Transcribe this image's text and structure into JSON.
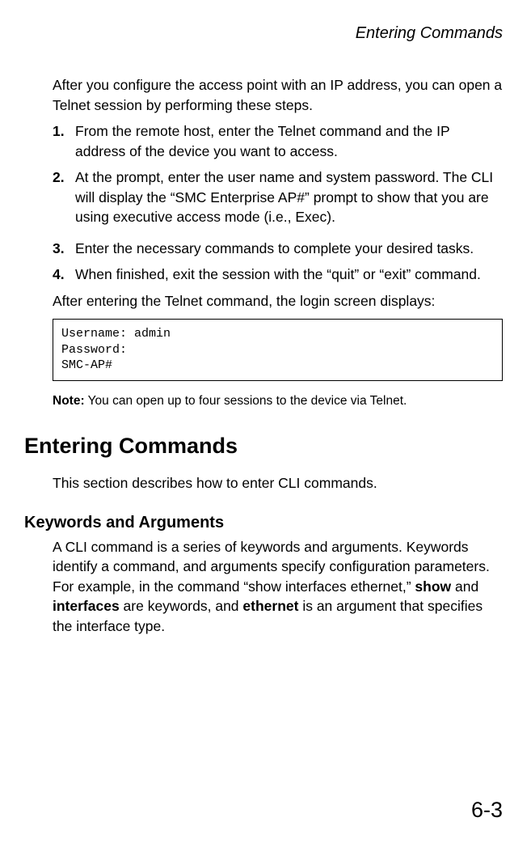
{
  "header": {
    "title": "Entering Commands"
  },
  "intro": "After you configure the access point with an IP address, you can open a Telnet session by performing these steps.",
  "steps": [
    {
      "num": "1.",
      "text": "From the remote host, enter the Telnet command and the IP address of the device you want to access."
    },
    {
      "num": "2.",
      "text": "At the prompt, enter the user name and system password. The CLI will display the “SMC Enterprise AP#” prompt to show that you are using executive access mode (i.e., Exec)."
    },
    {
      "num": "3.",
      "text": "Enter the necessary commands to complete your desired tasks."
    },
    {
      "num": "4.",
      "text": "When finished, exit the session with the “quit” or “exit” command."
    }
  ],
  "after_list": "After entering the Telnet command, the login screen displays:",
  "codebox": "Username: admin\nPassword:\nSMC-AP#",
  "note": {
    "label": "Note:",
    "text": "You can open up to four sessions to the device via Telnet."
  },
  "section": {
    "heading": "Entering Commands",
    "para": "This section describes how to enter CLI commands."
  },
  "subsection": {
    "heading": "Keywords and Arguments",
    "para_parts": {
      "p1": "A CLI command is a series of keywords and arguments. Keywords identify a command, and arguments specify configuration parameters. For example, in the command “show interfaces ethernet,” ",
      "b1": "show",
      "p2": " and ",
      "b2": "interfaces",
      "p3": " are keywords, and ",
      "b3": "ethernet",
      "p4": " is an argument that specifies the interface type."
    }
  },
  "page_number": "6-3"
}
